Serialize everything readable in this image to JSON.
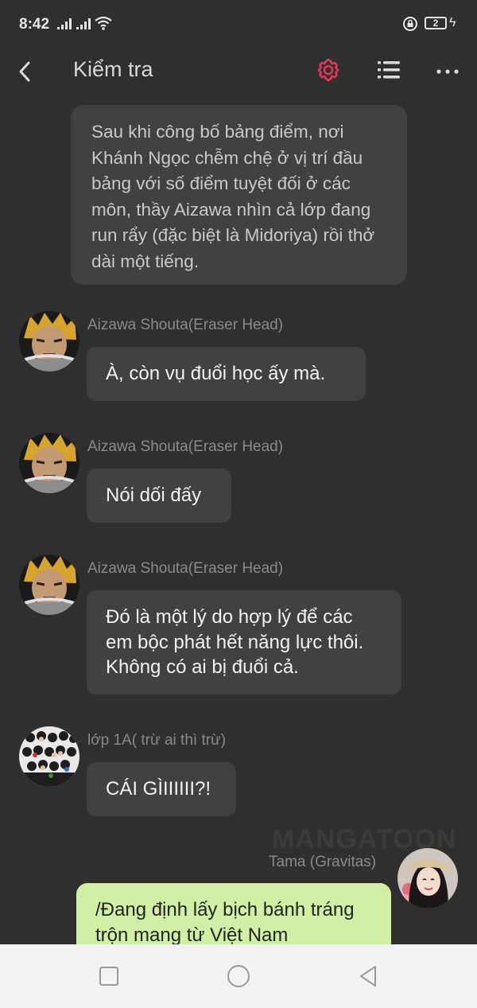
{
  "status": {
    "time": "8:42",
    "battery": "2"
  },
  "header": {
    "title": "Kiểm tra"
  },
  "colors": {
    "accent": "#e8335b",
    "bubble_dark": "#414141",
    "bubble_self": "#d1f0a6",
    "background": "#2f2f2f"
  },
  "chat": {
    "narration": "Sau khi công bố bảng điểm, nơi Khánh Ngọc chễm chệ ở vị trí đầu bảng với số điểm tuyệt đối ở các môn, thầy Aizawa nhìn cả lớp đang run rẩy (đặc biệt là Midoriya) rồi thở dài một tiếng.",
    "messages": [
      {
        "sender": "Aizawa Shouta(Eraser Head)",
        "text": "À, còn vụ đuổi học ấy mà."
      },
      {
        "sender": "Aizawa Shouta(Eraser Head)",
        "text": "Nói dối đấy"
      },
      {
        "sender": "Aizawa Shouta(Eraser Head)",
        "text": "Đó là một lý do hợp lý để các em bộc phát hết năng lực thôi. Không có ai bị đuổi cả."
      },
      {
        "sender": "lớp 1A( trừ ai thì trừ)",
        "text": "CÁI GÌIIIIII?!"
      },
      {
        "sender": "Tama (Gravitas)",
        "text": "/Đang định lấy bịch bánh tráng trộn mang từ Việt Nam"
      }
    ],
    "watermark": "MANGATOON"
  }
}
